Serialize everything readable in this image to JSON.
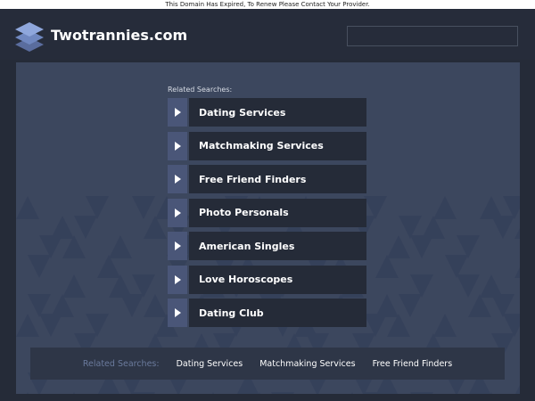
{
  "notice": "This Domain Has Expired, To Renew Please Contact Your Provider.",
  "header": {
    "logo_icon": "stacked-layers-icon",
    "site_name": "Twotrannies.com",
    "search_placeholder": ""
  },
  "main": {
    "related_label": "Related Searches:",
    "results": [
      {
        "label": "Dating Services"
      },
      {
        "label": "Matchmaking Services"
      },
      {
        "label": "Free Friend Finders"
      },
      {
        "label": "Photo Personals"
      },
      {
        "label": "American Singles"
      },
      {
        "label": "Love Horoscopes"
      },
      {
        "label": "Dating Club"
      }
    ]
  },
  "footer": {
    "related_label": "Related Searches:",
    "links": [
      {
        "label": "Dating Services"
      },
      {
        "label": "Matchmaking Services"
      },
      {
        "label": "Free Friend Finders"
      }
    ]
  },
  "colors": {
    "page_bg": "#252b38",
    "panel_bg": "#3c475e",
    "arrow_box": "#4a5678",
    "result_bg": "#252b38"
  }
}
